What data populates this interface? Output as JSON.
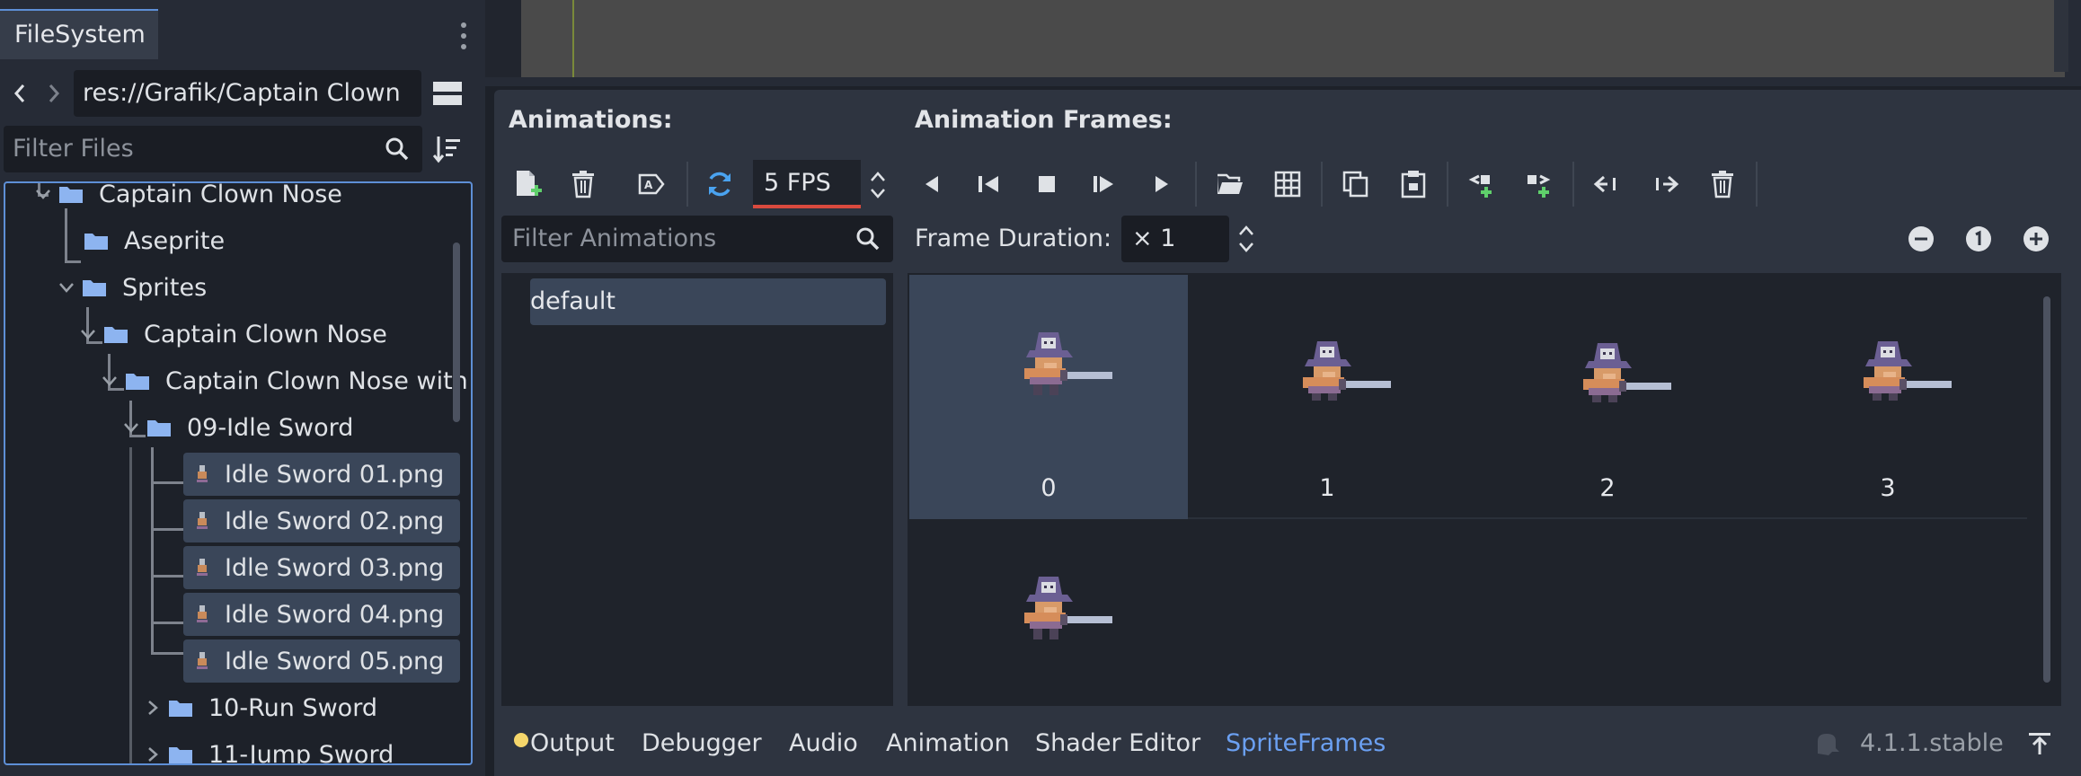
{
  "filesystem": {
    "tab_label": "FileSystem",
    "path": "res://Grafik/Captain Clown",
    "filter_placeholder": "Filter Files",
    "tree": [
      {
        "label": "Captain Clown Nose",
        "type": "folder",
        "expanded": true
      },
      {
        "label": "Aseprite",
        "type": "folder",
        "expanded": false
      },
      {
        "label": "Sprites",
        "type": "folder",
        "expanded": true
      },
      {
        "label": "Captain Clown Nose",
        "type": "folder",
        "expanded": true
      },
      {
        "label": "Captain Clown Nose with",
        "type": "folder",
        "expanded": true
      },
      {
        "label": "09-Idle Sword",
        "type": "folder",
        "expanded": true
      },
      {
        "label": "Idle Sword 01.png",
        "type": "file",
        "selected": true
      },
      {
        "label": "Idle Sword 02.png",
        "type": "file",
        "selected": true
      },
      {
        "label": "Idle Sword 03.png",
        "type": "file",
        "selected": true
      },
      {
        "label": "Idle Sword 04.png",
        "type": "file",
        "selected": true
      },
      {
        "label": "Idle Sword 05.png",
        "type": "file",
        "selected": true
      },
      {
        "label": "10-Run Sword",
        "type": "folder",
        "expanded": false
      },
      {
        "label": "11-Jump Sword",
        "type": "folder",
        "expanded": false
      }
    ]
  },
  "sprite_frames": {
    "animations_heading": "Animations:",
    "frames_heading": "Animation Frames:",
    "fps_value": "5 FPS",
    "filter_anims_placeholder": "Filter Animations",
    "animations": [
      "default"
    ],
    "frame_duration_label": "Frame Duration:",
    "frame_duration_value": "× 1",
    "frames": [
      "0",
      "1",
      "2",
      "3",
      ""
    ],
    "selected_frame": "0"
  },
  "bottom_bar": {
    "tabs": [
      "Output",
      "Debugger",
      "Audio",
      "Animation",
      "Shader Editor",
      "SpriteFrames"
    ],
    "active_tab": "SpriteFrames",
    "version": "4.1.1.stable"
  },
  "colors": {
    "accent": "#5e8fd6",
    "active_tab": "#6ba0f2",
    "selection": "#3a4659",
    "fps_underline": "#d94a3e",
    "output_dot": "#f5d66b",
    "add_icon_green": "#5fcf6b",
    "loop_icon_blue": "#4aa3f0",
    "folder": "#8db4f0"
  }
}
